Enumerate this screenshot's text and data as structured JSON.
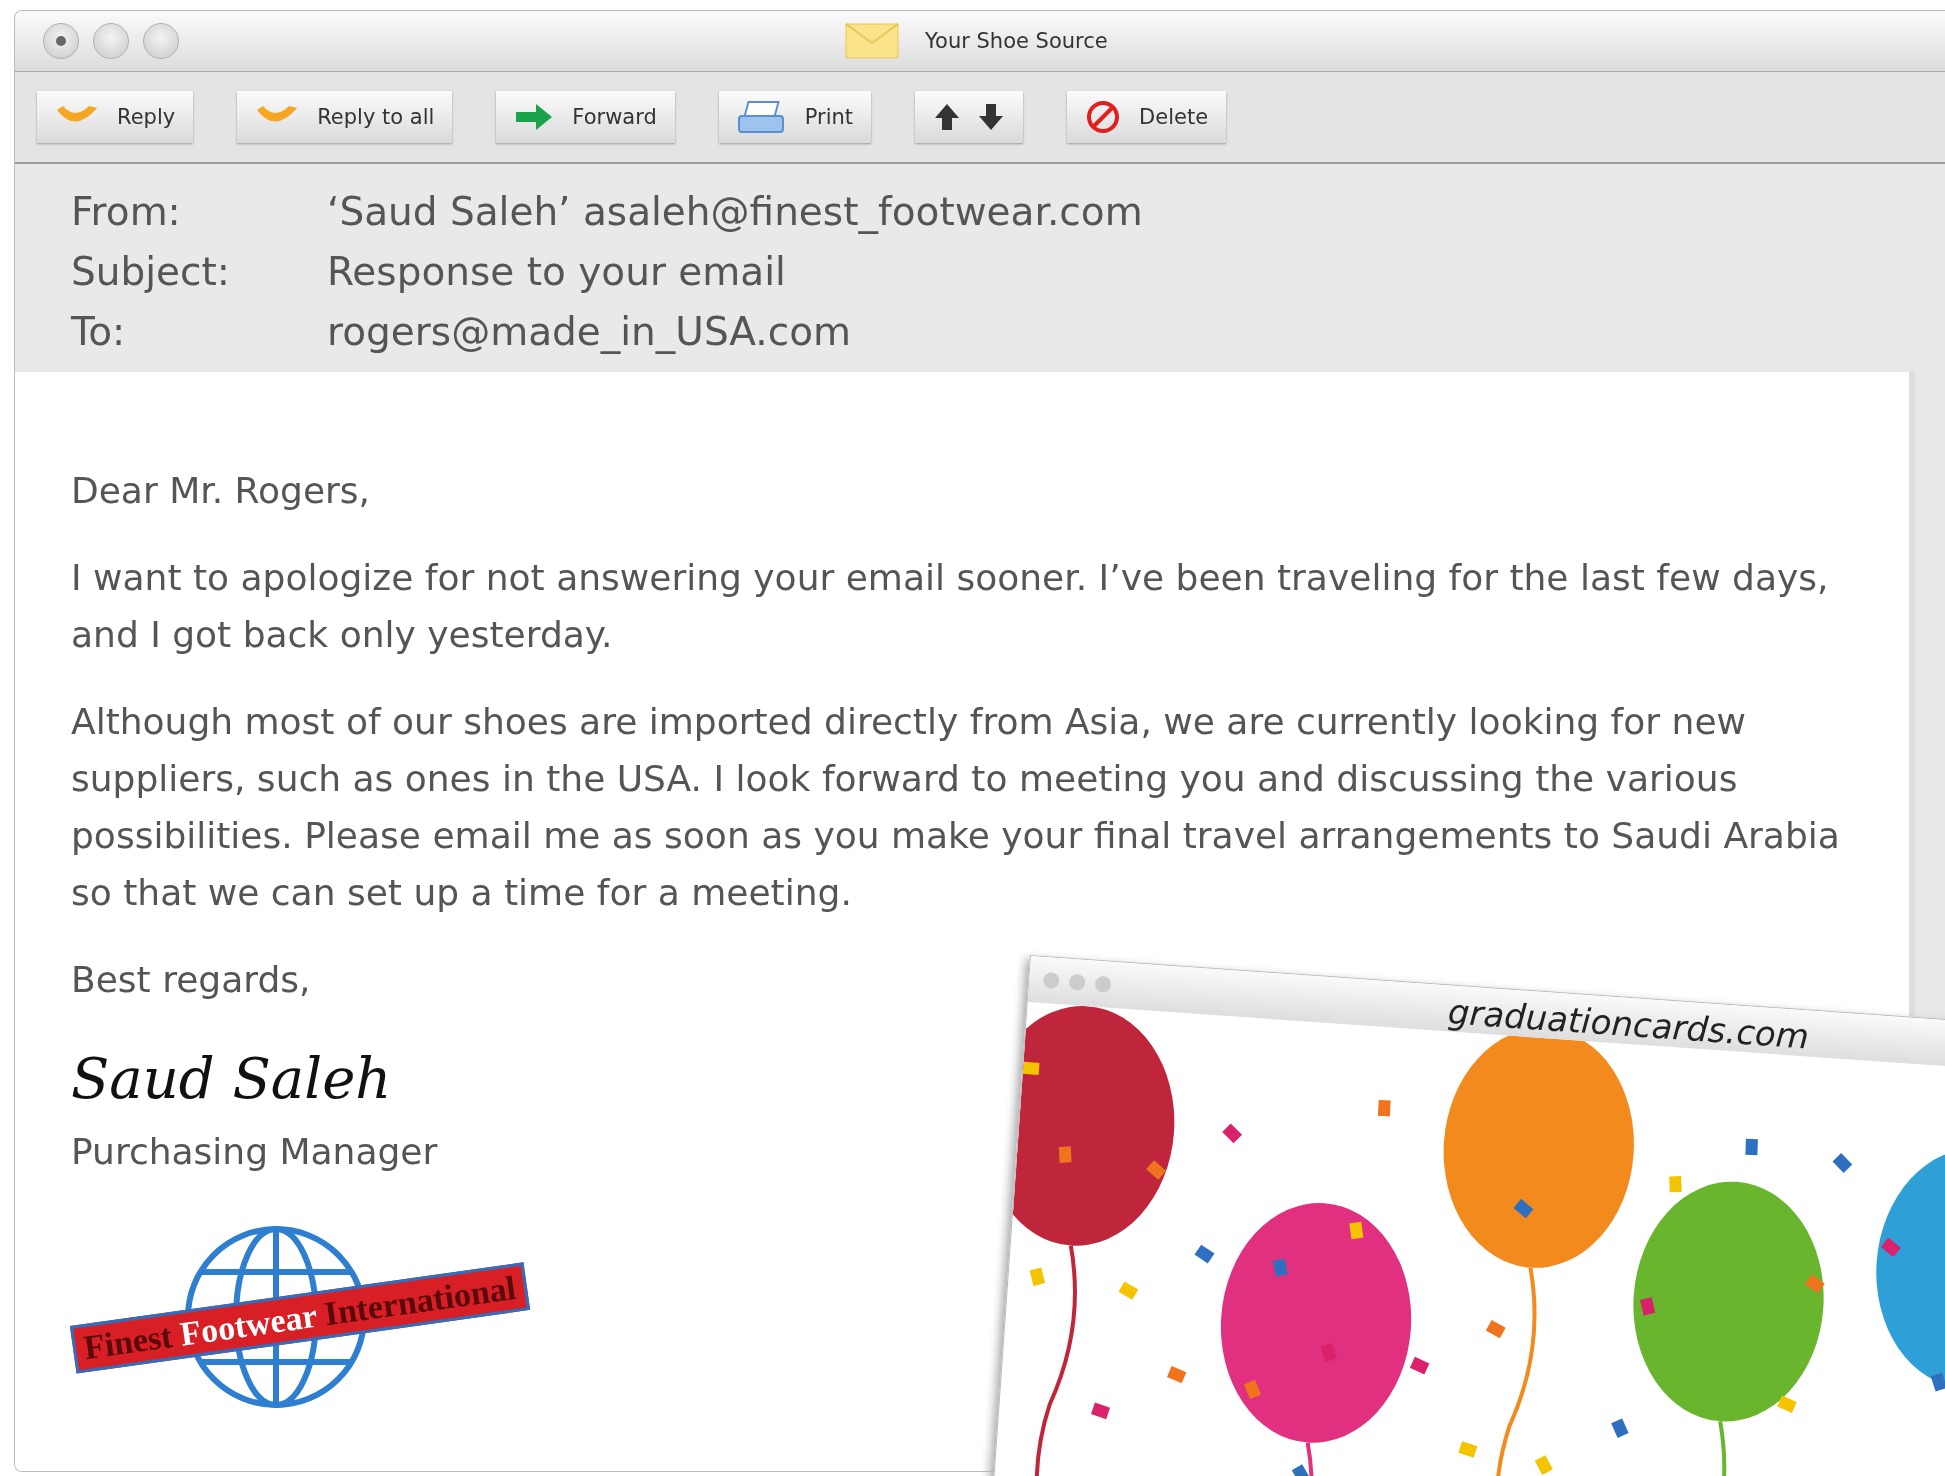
{
  "window": {
    "title": "Your Shoe Source"
  },
  "toolbar": [
    {
      "kind": "reply",
      "label": "Reply"
    },
    {
      "kind": "reply",
      "label": "Reply to all"
    },
    {
      "kind": "forward",
      "label": "Forward"
    },
    {
      "kind": "print",
      "label": "Print"
    },
    {
      "kind": "arrows"
    },
    {
      "kind": "delete",
      "label": "Delete"
    }
  ],
  "header": [
    {
      "label": "From:",
      "value": "‘Saud Saleh’ asaleh@finest_footwear.com"
    },
    {
      "label": "Subject:",
      "value": "Response to your email"
    },
    {
      "label": "To:",
      "value": "rogers@made_in_USA.com"
    }
  ],
  "body": {
    "greeting": "Dear Mr. Rogers,",
    "paragraphs": [
      "I want to apologize for not answering your email sooner. I’ve been traveling for the last few days, and I got back only yesterday.",
      "Although most of our shoes are imported directly from Asia, we are currently looking for new suppliers, such as ones in the USA. I look forward to meeting you and discussing the various possibilities. Please email me as soon as you make your final travel arrangements to Saudi Arabia so that we can set up a time for a meeting."
    ],
    "closing": "Best regards,",
    "signature": "Saud Saleh",
    "role": "Purchasing Manager"
  },
  "logo": {
    "words": [
      "Finest",
      "Footwear",
      "International"
    ]
  },
  "overlay_window": {
    "address": "graduationcards.com"
  }
}
